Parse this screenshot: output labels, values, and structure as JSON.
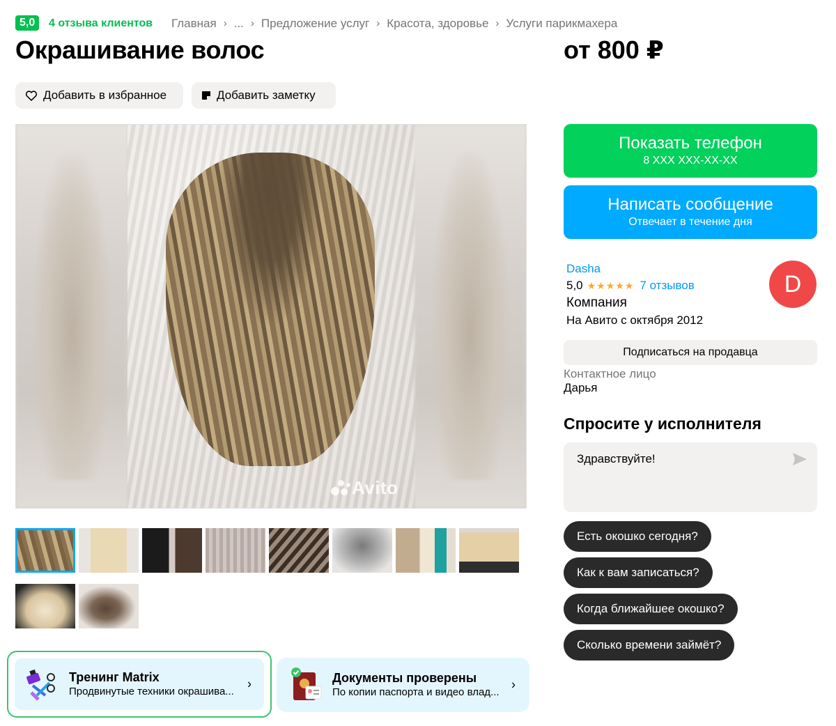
{
  "header": {
    "rating": "5,0",
    "reviews_link": "4 отзыва клиентов",
    "breadcrumbs": [
      "Главная",
      "...",
      "Предложение услуг",
      "Красота, здоровье",
      "Услуги парикмахера"
    ]
  },
  "listing": {
    "title": "Окрашивание волос",
    "price": "от 800 ₽",
    "add_favorite": "Добавить в избранное",
    "add_note": "Добавить заметку",
    "watermark": "Avito"
  },
  "gallery": {
    "thumbnail_count": 10,
    "active_index": 0
  },
  "cards": {
    "matrix": {
      "title": "Тренинг Matrix",
      "subtitle": "Продвинутые техники окрашива..."
    },
    "docs": {
      "title": "Документы проверены",
      "subtitle": "По копии паспорта и видео влад..."
    }
  },
  "contact": {
    "phone_label": "Показать телефон",
    "phone_mask": "8 XXX XXX-XX-XX",
    "message_label": "Написать сообщение",
    "message_sub": "Отвечает в течение дня"
  },
  "seller": {
    "name": "Dasha",
    "rating": "5,0",
    "stars": "★★★★★",
    "reviews": "7 отзывов",
    "type": "Компания",
    "since": "На Авито с октября 2012",
    "avatar_letter": "D",
    "subscribe": "Подписаться на продавца",
    "contact_label": "Контактное лицо",
    "contact_name": "Дарья"
  },
  "ask": {
    "title": "Спросите у исполнителя",
    "message": "Здравствуйте!",
    "chips": [
      "Есть окошко сегодня?",
      "Как к вам записаться?",
      "Когда ближайшее окошко?",
      "Сколько времени займёт?"
    ]
  },
  "colors": {
    "green": "#02d15c",
    "blue": "#00aaff",
    "link": "#0099f7",
    "avatar": "#f04849",
    "star": "#ffa826"
  }
}
